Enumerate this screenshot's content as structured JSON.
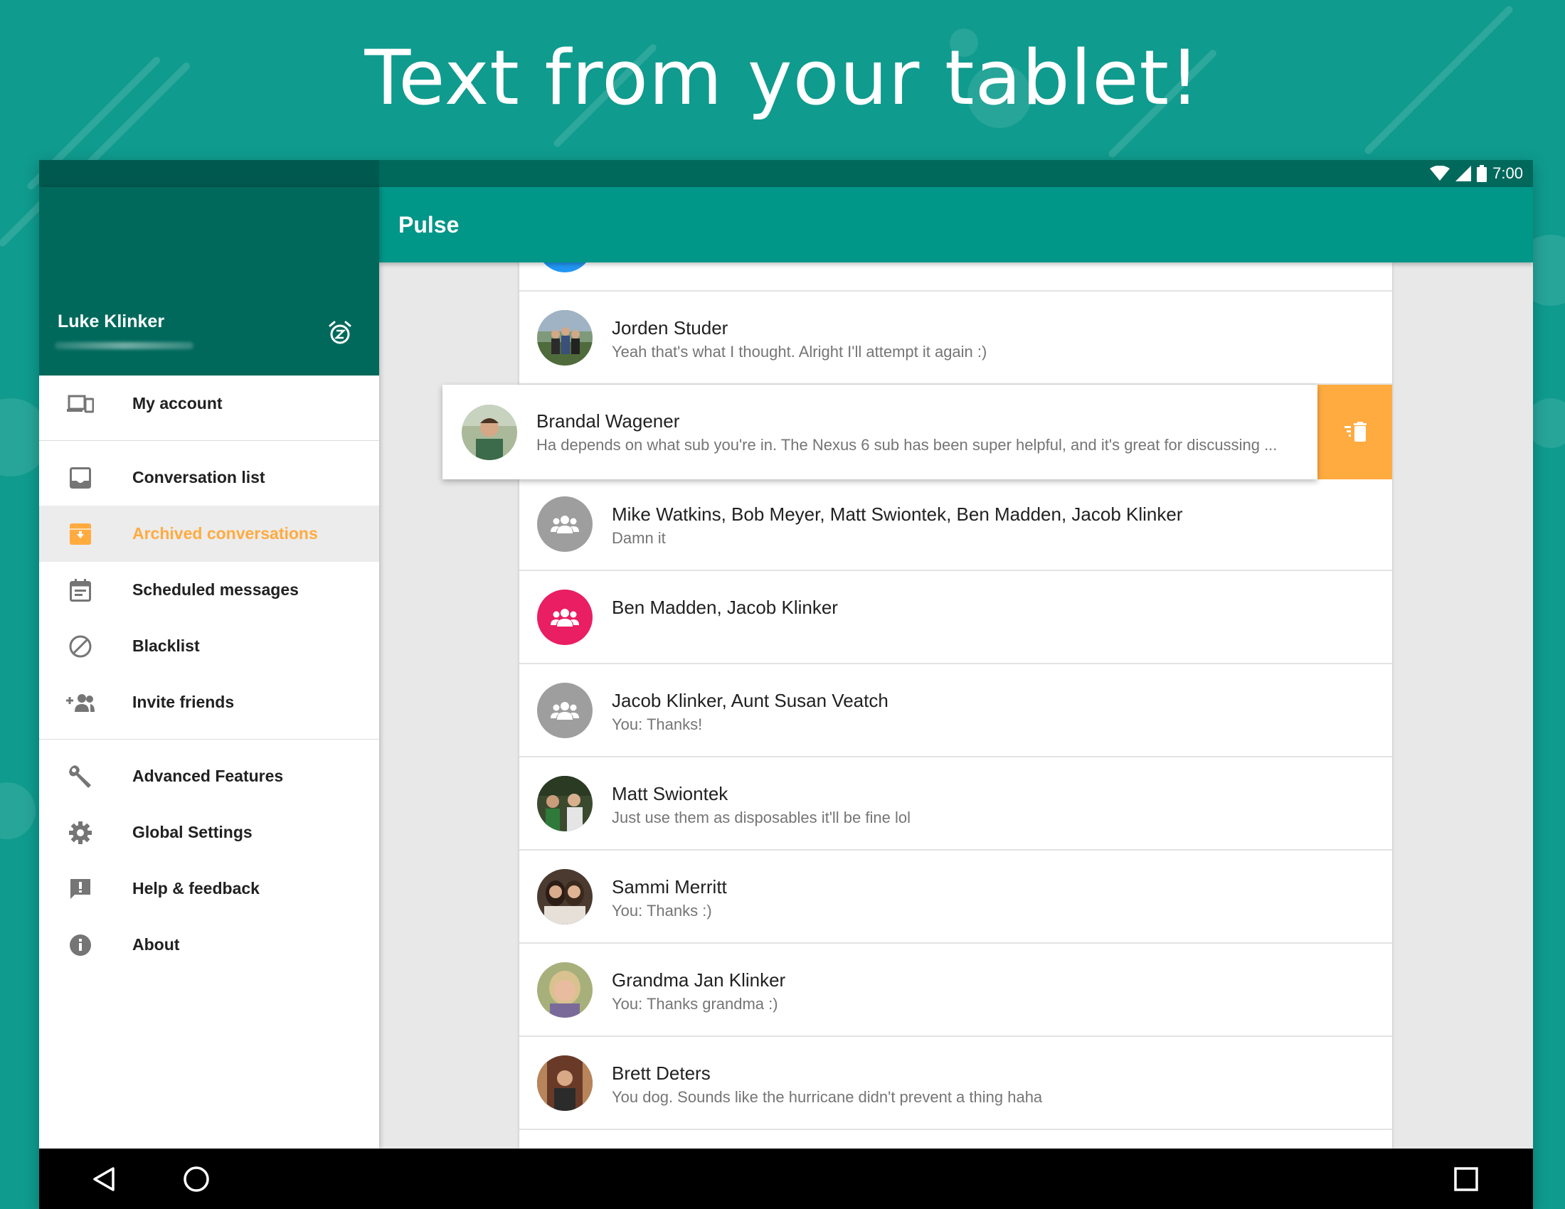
{
  "headline": "Text from your tablet!",
  "status_bar": {
    "time": "7:00"
  },
  "toolbar": {
    "title": "Pulse"
  },
  "drawer": {
    "user_name": "Luke Klinker",
    "items": [
      {
        "label": "My account",
        "icon": "devices-icon"
      },
      {
        "label": "Conversation list",
        "icon": "inbox-icon"
      },
      {
        "label": "Archived conversations",
        "icon": "archive-icon",
        "active": true
      },
      {
        "label": "Scheduled messages",
        "icon": "calendar-icon"
      },
      {
        "label": "Blacklist",
        "icon": "block-icon"
      },
      {
        "label": "Invite friends",
        "icon": "person-add-icon"
      },
      {
        "label": "Advanced Features",
        "icon": "wrench-icon"
      },
      {
        "label": "Global Settings",
        "icon": "gear-icon"
      },
      {
        "label": "Help & feedback",
        "icon": "feedback-icon"
      },
      {
        "label": "About",
        "icon": "info-icon"
      }
    ]
  },
  "conversations": [
    {
      "name": "Jorden Studer",
      "snippet": "Yeah that's what I thought. Alright I'll attempt it again :)"
    },
    {
      "name": "Brandal Wagener",
      "snippet": "Ha depends on what sub you're in. The Nexus 6 sub has been super helpful, and it's great for discussing ..."
    },
    {
      "name": "Mike Watkins, Bob Meyer, Matt Swiontek, Ben Madden, Jacob Klinker",
      "snippet": "Damn it"
    },
    {
      "name": "Ben Madden, Jacob Klinker",
      "snippet": ""
    },
    {
      "name": "Jacob Klinker, Aunt Susan Veatch",
      "snippet": "You: Thanks!"
    },
    {
      "name": "Matt Swiontek",
      "snippet": "Just use them as disposables it'll be fine lol"
    },
    {
      "name": "Sammi Merritt",
      "snippet": "You: Thanks :)"
    },
    {
      "name": "Grandma Jan Klinker",
      "snippet": "You: Thanks grandma :)"
    },
    {
      "name": "Brett Deters",
      "snippet": "You dog. Sounds like the hurricane didn't prevent a thing haha"
    }
  ],
  "colors": {
    "background": "#0f9b8e",
    "primary": "#009688",
    "primary_dark": "#00695c",
    "accent": "#ffab40",
    "group_avatar_gray": "#9e9e9e",
    "group_avatar_pink": "#e91e63"
  }
}
